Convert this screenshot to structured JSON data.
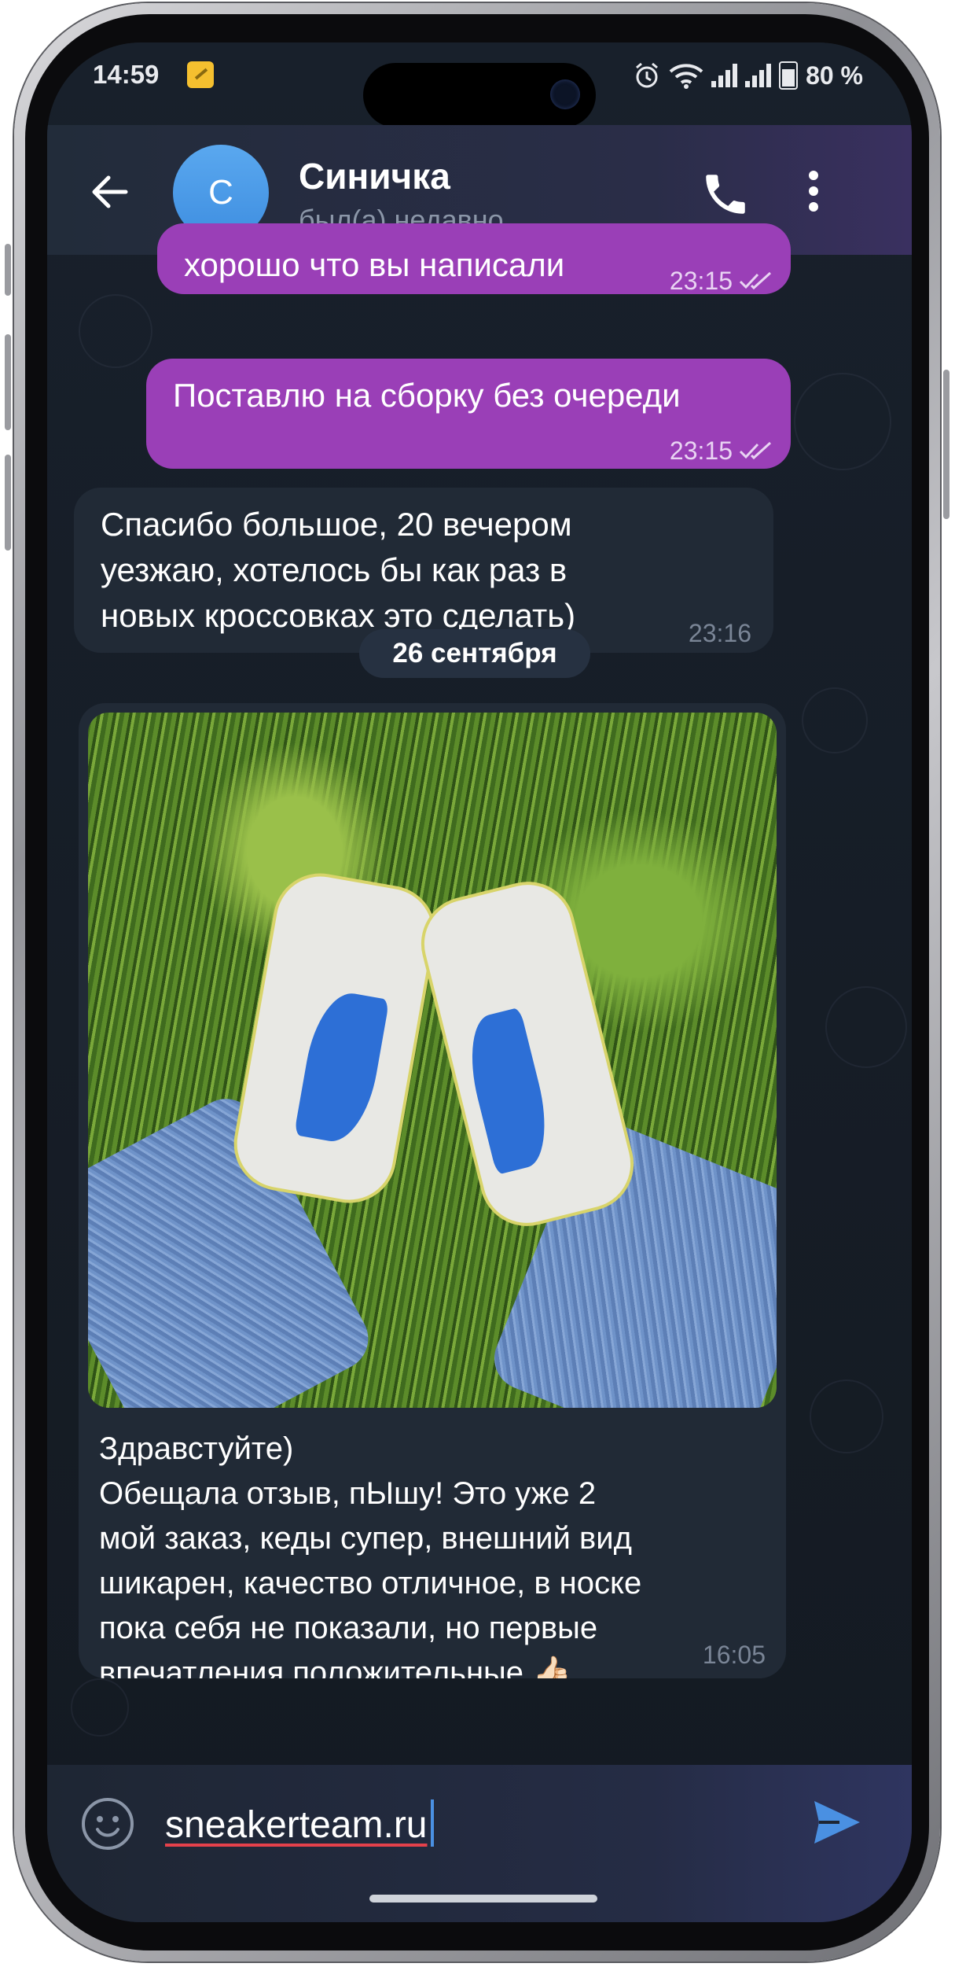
{
  "status_bar": {
    "time": "14:59",
    "battery": "80 %"
  },
  "header": {
    "back_icon": "arrow-left-icon",
    "avatar_letter": "С",
    "contact_name": "Синичка",
    "contact_status": "был(а) недавно",
    "call_icon": "phone-icon",
    "menu_icon": "more-vertical-icon"
  },
  "messages": [
    {
      "direction": "out",
      "text": "хорошо что вы написали",
      "time": "23:15",
      "read": true
    },
    {
      "direction": "out",
      "text": "Поставлю на сборку без очереди",
      "time": "23:15",
      "read": true
    },
    {
      "direction": "in",
      "lines": [
        "Спасибо большое, 20 вечером",
        "уезжаю, хотелось бы как раз в",
        "новых кроссовках это сделать)"
      ],
      "time": "23:16"
    }
  ],
  "date_separator": "26 сентября",
  "photo_message": {
    "lines": [
      "Здравстуйте)",
      "Обещала отзыв, пЫшу! Это уже 2",
      "мой заказ, кеды супер, внешний вид",
      "шикарен, качество отличное, в носке",
      "пока себя не показали, но первые",
      "впечатления положительные"
    ],
    "emoji": "👍🏻",
    "time": "16:05"
  },
  "input": {
    "emoji_icon": "smile-icon",
    "value": "sneakerteam.ru",
    "send_icon": "send-icon"
  },
  "colors": {
    "outgoing_bubble": "#9a3fb7",
    "incoming_bubble": "#212a36",
    "background": "#151b24",
    "accent": "#4a90e2"
  }
}
